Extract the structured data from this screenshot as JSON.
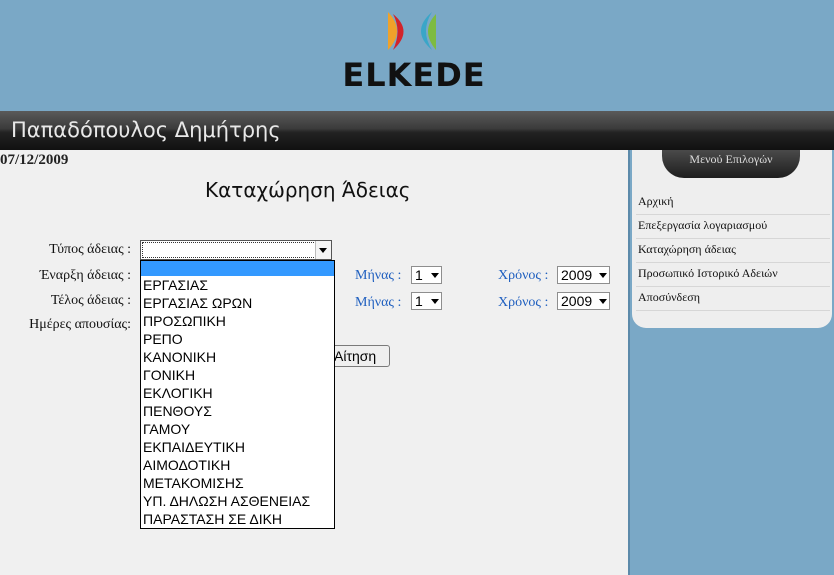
{
  "header": {
    "logo_text": "ELKEDE",
    "colors": {
      "background": "#7aa8c6",
      "logo_orange": "#f0a22a",
      "logo_red": "#d2232a",
      "logo_teal": "#3aa6c8",
      "logo_green": "#7dbb42"
    }
  },
  "user_bar": {
    "name": "Παπαδόπουλος Δημήτρης"
  },
  "date": "07/12/2009",
  "form": {
    "title": "Καταχώρηση Άδειας",
    "type_label": "Τύπος άδειας :",
    "type_value": "",
    "start_label": "Έναρξη άδειας :",
    "end_label": "Τέλος άδειας :",
    "days_label": "Ημέρες απουσίας:",
    "month_label": "Μήνας :",
    "year_label": "Χρόνος :",
    "start_month": "1",
    "start_year": "2009",
    "end_month": "1",
    "end_year": "2009",
    "submit_label": "Αίτηση"
  },
  "type_options": [
    "",
    "ΕΡΓΑΣΙΑΣ",
    "ΕΡΓΑΣΙΑΣ ΩΡΩΝ",
    "ΠΡΟΣΩΠΙΚΗ",
    "ΡΕΠΟ",
    "ΚΑΝΟΝΙΚΗ",
    "ΓΟΝΙΚΗ",
    "ΕΚΛΟΓΙΚΗ",
    "ΠΕΝΘΟΥΣ",
    "ΓΑΜΟΥ",
    "ΕΚΠΑΙΔΕΥΤΙΚΗ",
    "ΑΙΜΟΔΟΤΙΚΗ",
    "ΜΕΤΑΚΟΜΙΣΗΣ",
    "ΥΠ. ΔΗΛΩΣΗ ΑΣΘΕΝΕΙΑΣ",
    "ΠΑΡΑΣΤΑΣΗ ΣΕ ΔΙΚΗ"
  ],
  "sidebar": {
    "title": "Μενού Επιλογών",
    "items": [
      "Αρχική",
      "Επεξεργασία λογαριασμού",
      "Καταχώρηση άδειας",
      "Προσωπικό Ιστορικό Αδειών",
      "Αποσύνδεση"
    ]
  }
}
